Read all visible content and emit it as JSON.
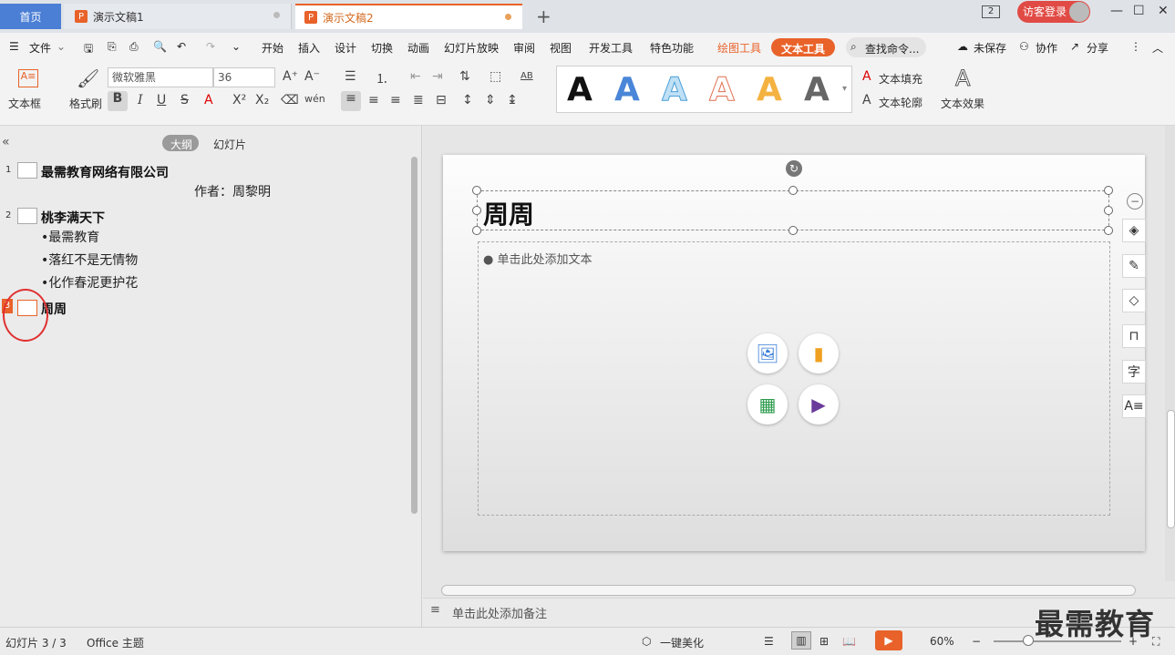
{
  "tabs": {
    "home": "首页",
    "doc1": "演示文稿1",
    "doc2": "演示文稿2",
    "window_count": "2",
    "login": "访客登录"
  },
  "menu": {
    "file": "文件",
    "items": [
      "开始",
      "插入",
      "设计",
      "切换",
      "动画",
      "幻灯片放映",
      "审阅",
      "视图",
      "开发工具",
      "特色功能"
    ],
    "drawing_tools": "绘图工具",
    "text_tools": "文本工具",
    "search": "查找命令...",
    "unsaved": "未保存",
    "collab": "协作",
    "share": "分享"
  },
  "ribbon": {
    "textbox": "文本框",
    "format_brush": "格式刷",
    "font": "微软雅黑",
    "font_size": "36",
    "text_fill": "文本填充",
    "text_outline": "文本轮廓",
    "text_effect": "文本效果",
    "wordart_letter": "A"
  },
  "outline": {
    "tab_outline": "大纲",
    "tab_slides": "幻灯片",
    "slides": [
      {
        "num": "1",
        "title": "最需教育网络有限公司",
        "sub": "作者：周黎明"
      },
      {
        "num": "2",
        "title": "桃李满天下",
        "bullets": [
          "•最需教育",
          "•落红不是无情物",
          "•化作春泥更护花"
        ]
      },
      {
        "num": "3",
        "title": "周周"
      }
    ]
  },
  "slide": {
    "title": "周周",
    "placeholder": "● 单击此处添加文本"
  },
  "notes": "单击此处添加备注",
  "status": {
    "slide_count": "幻灯片 3 / 3",
    "theme": "Office 主题",
    "beautify": "一键美化",
    "zoom": "60%"
  },
  "watermark": "最需教育",
  "colors": {
    "accent": "#e8622a",
    "tab_blue": "#4b7fd5",
    "login_red": "#e14b45"
  }
}
